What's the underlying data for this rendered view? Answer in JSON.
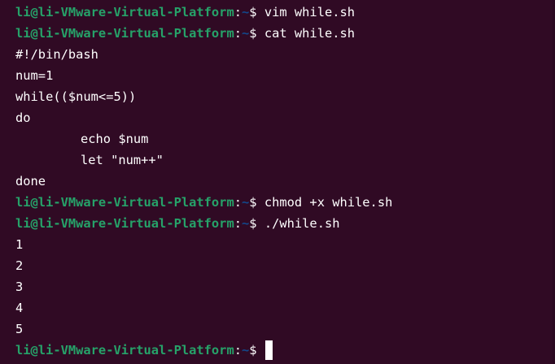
{
  "terminal": {
    "prompt": {
      "user_host": "li@li-VMware-Virtual-Platform",
      "separator": ":",
      "path": "~",
      "symbol": "$"
    },
    "commands": {
      "cmd1": " vim while.sh",
      "cmd2": " cat while.sh",
      "cmd3": " chmod +x while.sh",
      "cmd4": " ./while.sh"
    },
    "file_lines": [
      "#!/bin/bash",
      "num=1",
      "while(($num<=5))",
      "do",
      "echo $num",
      "let \"num++\"",
      "done"
    ],
    "output_lines": [
      "1",
      "2",
      "3",
      "4",
      "5"
    ]
  }
}
